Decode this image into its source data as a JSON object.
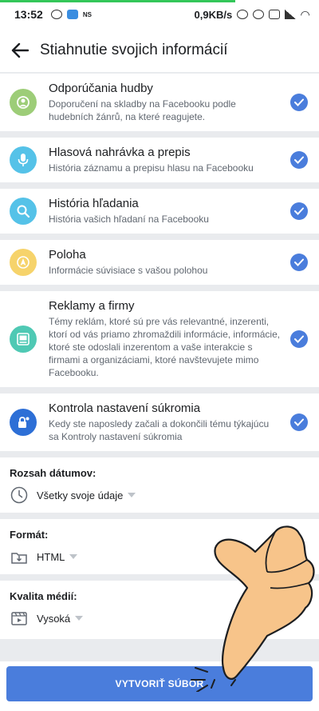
{
  "status": {
    "time": "13:52",
    "left_mini": "NS",
    "speed": "0,9KB/s"
  },
  "header": {
    "title": "Stiahnutie svojich informácií"
  },
  "categories": [
    {
      "title": "Odporúčania hudby",
      "desc": "Doporučení na skladby na Facebooku podle hudebních žánrů, na které reagujete.",
      "icon": "music-icon",
      "color": "#9dcd78"
    },
    {
      "title": "Hlasová nahrávka a prepis",
      "desc": "História záznamu a prepisu hlasu na Facebooku",
      "icon": "microphone-icon",
      "color": "#55c2e8"
    },
    {
      "title": "História hľadania",
      "desc": "História vašich hľadaní na Facebooku",
      "icon": "search-icon",
      "color": "#55c2e8"
    },
    {
      "title": "Poloha",
      "desc": "Informácie súvisiace s vašou polohou",
      "icon": "location-icon",
      "color": "#f6d36b"
    },
    {
      "title": "Reklamy a firmy",
      "desc": "Témy reklám, ktoré sú pre vás relevantné, inzerenti, ktorí od vás priamo zhromaždili informácie, informácie, ktoré ste odoslali inzerentom a vaše interakcie s firmami a organizáciami, ktoré navštevujete mimo Facebooku.",
      "icon": "ads-icon",
      "color": "#4fc9b4"
    },
    {
      "title": "Kontrola nastavení súkromia",
      "desc": "Kedy ste naposledy začali a dokončili tému týkajúcu sa Kontroly nastavení súkromia",
      "icon": "privacy-icon",
      "color": "#2d6fd6"
    }
  ],
  "date_range": {
    "label": "Rozsah dátumov:",
    "value": "Všetky svoje údaje"
  },
  "format": {
    "label": "Formát:",
    "value": "HTML"
  },
  "quality": {
    "label": "Kvalita médií:",
    "value": "Vysoká"
  },
  "create_button": {
    "label": "VYTVORIŤ SÚBOR"
  }
}
